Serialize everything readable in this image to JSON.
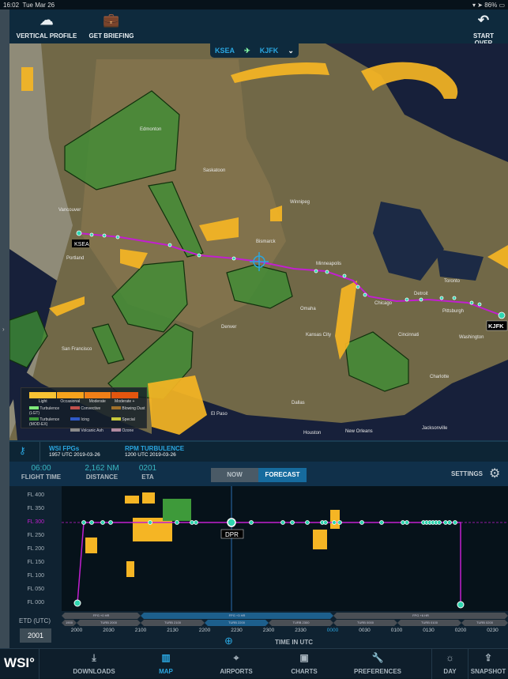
{
  "status_bar": {
    "time": "16:02",
    "date": "Tue Mar 26",
    "battery": "86%"
  },
  "toolbar": {
    "vertical_profile": "VERTICAL PROFILE",
    "get_briefing": "GET BRIEFING",
    "start_over": "START OVER"
  },
  "route": {
    "origin": "KSEA",
    "destination": "KJFK"
  },
  "map": {
    "cities": [
      "Vancouver",
      "Portland",
      "San Francisco",
      "Saskatoon",
      "Winnipeg",
      "Bismarck",
      "Minneapolis",
      "Chicago",
      "Detroit",
      "Toronto",
      "Pittsburgh",
      "Washington",
      "Cincinnati",
      "Charlotte",
      "Kansas City",
      "Omaha",
      "Denver",
      "Dallas",
      "Houston",
      "New Orleans",
      "Jacksonville",
      "Edmonton",
      "El Paso"
    ],
    "origin_tag": "KSEA",
    "dest_tag": "KJFK"
  },
  "legend": {
    "intensity": [
      "Light",
      "Occasional",
      "Moderate",
      "Moderate +"
    ],
    "intensity_colors": [
      "#f7c233",
      "#f5a21c",
      "#f07f17",
      "#e3560e"
    ],
    "items": [
      {
        "label": "Turbulence (LGT)",
        "color": "#7ee87a"
      },
      {
        "label": "Convective",
        "color": "#c0504d"
      },
      {
        "label": "Blowing Dust",
        "color": "#a0702a"
      },
      {
        "label": "Turbulence (MOD-EX)",
        "color": "#3e9a3a"
      },
      {
        "label": "Icing",
        "color": "#2f59c8"
      },
      {
        "label": "Special",
        "color": "#c9c93a"
      },
      {
        "label": "Volcanic Ash",
        "color": "#8a8a8a"
      },
      {
        "label": "Ozone",
        "color": "#b08aa0"
      }
    ]
  },
  "keybar": {
    "src1_title": "WSI FPGs",
    "src1_time": "1957 UTC 2019-03-26",
    "src2_title": "RPM TURBULENCE",
    "src2_time": "1200 UTC 2019-03-26"
  },
  "stats": {
    "flight_time": "06:00",
    "flight_time_label": "FLIGHT TIME",
    "distance": "2,162 NM",
    "distance_label": "DISTANCE",
    "eta": "0201",
    "eta_label": "ETA",
    "now": "NOW",
    "forecast": "FORECAST",
    "settings": "SETTINGS"
  },
  "profile": {
    "levels": [
      "FL 400",
      "FL 350",
      "FL 300",
      "FL 250",
      "FL 200",
      "FL 150",
      "FL 100",
      "FL 050",
      "FL 000"
    ],
    "cruise": "FL 300",
    "waypoint": "DPR"
  },
  "timeline": {
    "etd_label": "ETD (UTC)",
    "etd": "2001",
    "axis_label": "TIME IN UTC",
    "ticks": [
      "2000",
      "2030",
      "2100",
      "2130",
      "2200",
      "2230",
      "2300",
      "2330",
      "0000",
      "0030",
      "0100",
      "0130",
      "0200",
      "0230"
    ],
    "fpg": [
      "FPG +0 HR",
      "FPG +3 HR",
      "FPG +6 HR"
    ],
    "turb": [
      "1900",
      "TURB 2000",
      "TURB 2100",
      "TURB 2200",
      "TURB 2300",
      "TURB 0000",
      "TURB 0100",
      "TURB 0200"
    ]
  },
  "tabs": {
    "logo": "WSI°",
    "downloads": "DOWNLOADS",
    "map": "MAP",
    "airports": "AIRPORTS",
    "charts": "CHARTS",
    "preferences": "PREFERENCES",
    "day": "DAY",
    "snapshot": "SNAPSHOT"
  },
  "colors": {
    "accent": "#2aa6e0",
    "route": "#c21fd0",
    "waypoint": "#2fd6b0"
  }
}
